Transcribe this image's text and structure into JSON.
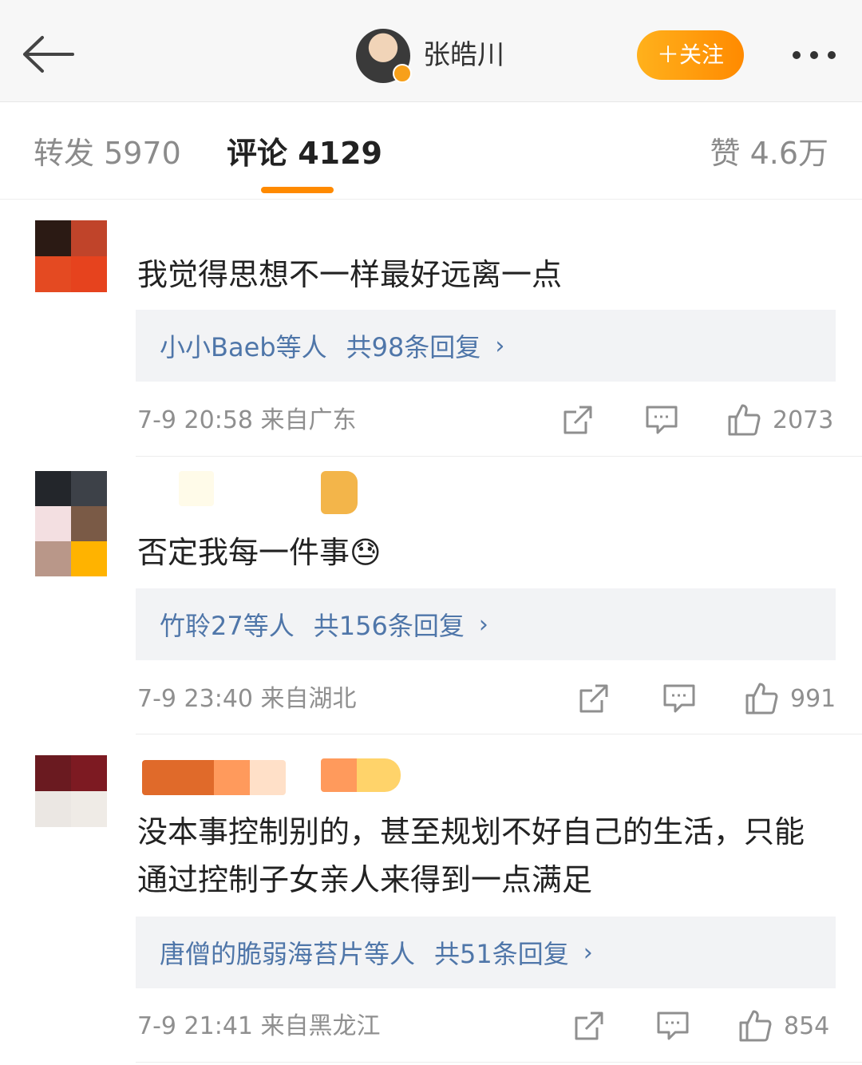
{
  "header": {
    "author_name": "张皓川",
    "follow_label": "＋关注"
  },
  "tabs": [
    {
      "label": "转发 5970"
    },
    {
      "label": "评论 4129"
    },
    {
      "label": "赞 4.6万"
    }
  ],
  "comments": [
    {
      "text": "我觉得思想不一样最好远离一点",
      "reply_users": "小小Baeb等人",
      "reply_count": "共98条回复",
      "time_location": "7-9 20:58  来自广东",
      "likes": "2073"
    },
    {
      "text": "否定我每一件事😓",
      "reply_users": "竹聆27等人",
      "reply_count": "共156条回复",
      "time_location": "7-9 23:40  来自湖北",
      "likes": "991"
    },
    {
      "text": "没本事控制别的，甚至规划不好自己的生活，只能通过控制子女亲人来得到一点满足",
      "reply_users": "唐僧的脆弱海苔片等人",
      "reply_count": "共51条回复",
      "time_location": "7-9 21:41  来自黑龙江",
      "likes": "854"
    }
  ],
  "icons": {
    "back": "arrow-left-icon",
    "more": "more-dots-icon",
    "repost": "share-square-icon",
    "comment": "comment-bubble-icon",
    "like": "thumbs-up-icon"
  },
  "colors": {
    "accent": "#ff8a00",
    "link": "#4f76a9",
    "meta": "#8f8f8f"
  }
}
